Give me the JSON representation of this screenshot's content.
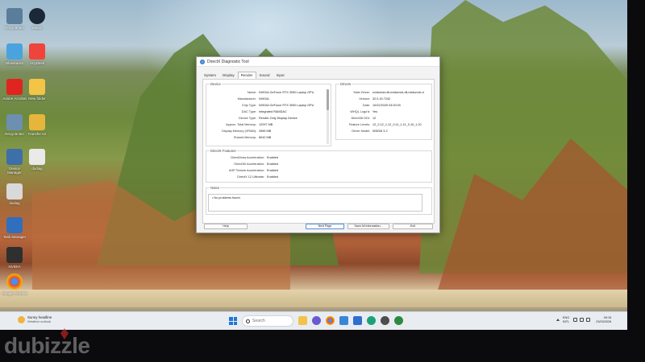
{
  "desktop": {
    "icons": [
      {
        "label": "Recycle Bin",
        "icon": "recycle-bin-icon",
        "color": "#5b7d9c"
      },
      {
        "label": "Steam",
        "icon": "steam-icon",
        "color": "#1b2838"
      },
      {
        "label": "Bluestacks",
        "icon": "bluestacks-icon",
        "color": "#4aa3df"
      },
      {
        "label": "AnyDesk",
        "icon": "anydesk-icon",
        "color": "#ef443b"
      },
      {
        "label": "Adobe Acrobat",
        "icon": "acrobat-icon",
        "color": "#e0241f"
      },
      {
        "label": "New folder",
        "icon": "folder-icon",
        "color": "#f3c446"
      },
      {
        "label": "Recycle Bin",
        "icon": "recycle-bin-icon",
        "color": "#6d8fb0"
      },
      {
        "label": "Transfer Kit",
        "icon": "folder-icon",
        "color": "#e6b63c"
      },
      {
        "label": "Device Manager",
        "icon": "computer-icon",
        "color": "#3d6fa8"
      },
      {
        "label": "dxdiag",
        "icon": "file-icon",
        "color": "#eaeaea"
      },
      {
        "label": "dxdiag",
        "icon": "file-icon",
        "color": "#d9d9d9"
      },
      {
        "label": "Task Manager",
        "icon": "task-manager-icon",
        "color": "#2f6fbe"
      },
      {
        "label": "NVIDIA",
        "icon": "nvidia-icon",
        "color": "#2f2f2f"
      },
      {
        "label": "Google Chrome",
        "icon": "chrome-icon",
        "color": "#e94235"
      }
    ]
  },
  "window": {
    "title": "DirectX Diagnostic Tool",
    "tabs": [
      "System",
      "Display",
      "Render",
      "Sound",
      "Input"
    ],
    "active_tab": "Render",
    "device": {
      "label": "Device",
      "rows": [
        {
          "k": "Name:",
          "v": "NVIDIA GeForce RTX 3050 Laptop GPU"
        },
        {
          "k": "Manufacturer:",
          "v": "NVIDIA"
        },
        {
          "k": "Chip Type:",
          "v": "NVIDIA GeForce RTX 3050 Laptop GPU"
        },
        {
          "k": "DAC Type:",
          "v": "Integrated RAMDAC"
        },
        {
          "k": "Device Type:",
          "v": "Render-Only Display Device"
        },
        {
          "k": "Approx. Total Memory:",
          "v": "12097 MB"
        },
        {
          "k": "Display Memory (VRAM):",
          "v": "3965 MB"
        },
        {
          "k": "Shared Memory:",
          "v": "8042 MB"
        }
      ]
    },
    "drivers": {
      "label": "Drivers",
      "rows": [
        {
          "k": "Main Driver:",
          "v": "nvldumdx.dll,nvldumdx.dll,nvldumdx.d"
        },
        {
          "k": "Version:",
          "v": "32.0.15.7242"
        },
        {
          "k": "Date:",
          "v": "10/22/2025 03:00:00"
        },
        {
          "k": "WHQL Logo'd:",
          "v": "Yes"
        },
        {
          "k": "Direct3D DDI:",
          "v": "12"
        },
        {
          "k": "Feature Levels:",
          "v": "12_2,12_1,12_0,11_1,11_0,10_1,10"
        },
        {
          "k": "Driver Model:",
          "v": "WDDM 3.2"
        }
      ]
    },
    "features": {
      "label": "DirectX Features",
      "rows": [
        {
          "k": "DirectDraw Acceleration:",
          "v": "Enabled"
        },
        {
          "k": "Direct3D Acceleration:",
          "v": "Enabled"
        },
        {
          "k": "AGP Texture Acceleration:",
          "v": "Enabled"
        },
        {
          "k": "DirectX 12 Ultimate:",
          "v": "Enabled"
        }
      ]
    },
    "notes": {
      "label": "Notes",
      "items": [
        "No problems found."
      ]
    },
    "buttons": {
      "help": "Help",
      "next_page": "Next Page",
      "save_all": "Save All Information...",
      "exit": "Exit"
    }
  },
  "taskbar": {
    "weather_title": "Sunny headline",
    "weather_sub": "Weather outlook",
    "search_placeholder": "Search",
    "apps": [
      {
        "icon": "file-explorer-icon",
        "color": "#f1c34a"
      },
      {
        "icon": "copilot-icon",
        "color": "#6a5acd"
      },
      {
        "icon": "chrome-icon",
        "color": "#e94235"
      },
      {
        "icon": "app-icon",
        "color": "#3a86d6"
      },
      {
        "icon": "store-icon",
        "color": "#2e6fcf"
      },
      {
        "icon": "edge-icon",
        "color": "#1aa37a"
      },
      {
        "icon": "settings-icon",
        "color": "#4d4d4d"
      },
      {
        "icon": "xbox-icon",
        "color": "#2b8a3e"
      }
    ],
    "language_top": "ENG",
    "language_bottom": "INTL",
    "time": "09:15",
    "date": "23/03/2026"
  },
  "watermark": "dubizzle"
}
